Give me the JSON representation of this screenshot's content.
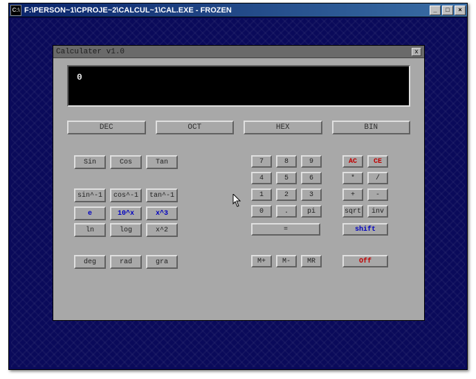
{
  "outer": {
    "title": "F:\\PERSON~1\\CPROJE~2\\CALCUL~1\\CAL.EXE - FROZEN",
    "sys_icon": "C:\\",
    "min": "_",
    "max": "□",
    "close": "×"
  },
  "calc": {
    "title": "Calculater v1.0",
    "close": "x",
    "display": "0"
  },
  "modes": {
    "dec": "DEC",
    "oct": "OCT",
    "hex": "HEX",
    "bin": "BIN"
  },
  "trig": {
    "sin": "Sin",
    "cos": "Cos",
    "tan": "Tan",
    "asin": "sin^-1",
    "acos": "cos^-1",
    "atan": "tan^-1",
    "e": "e",
    "tenx": "10^x",
    "x3": "x^3",
    "ln": "ln",
    "log": "log",
    "x2": "x^2",
    "deg": "deg",
    "rad": "rad",
    "gra": "gra"
  },
  "num": {
    "7": "7",
    "8": "8",
    "9": "9",
    "4": "4",
    "5": "5",
    "6": "6",
    "1": "1",
    "2": "2",
    "3": "3",
    "0": "0",
    "dot": ".",
    "pi": "pi",
    "eq": "="
  },
  "ops": {
    "ac": "AC",
    "ce": "CE",
    "mul": "*",
    "div": "/",
    "add": "+",
    "sub": "-",
    "sqrt": "sqrt",
    "inv": "inv",
    "shift": "shift",
    "off": "Off"
  },
  "mem": {
    "mplus": "M+",
    "mminus": "M-",
    "mr": "MR"
  }
}
